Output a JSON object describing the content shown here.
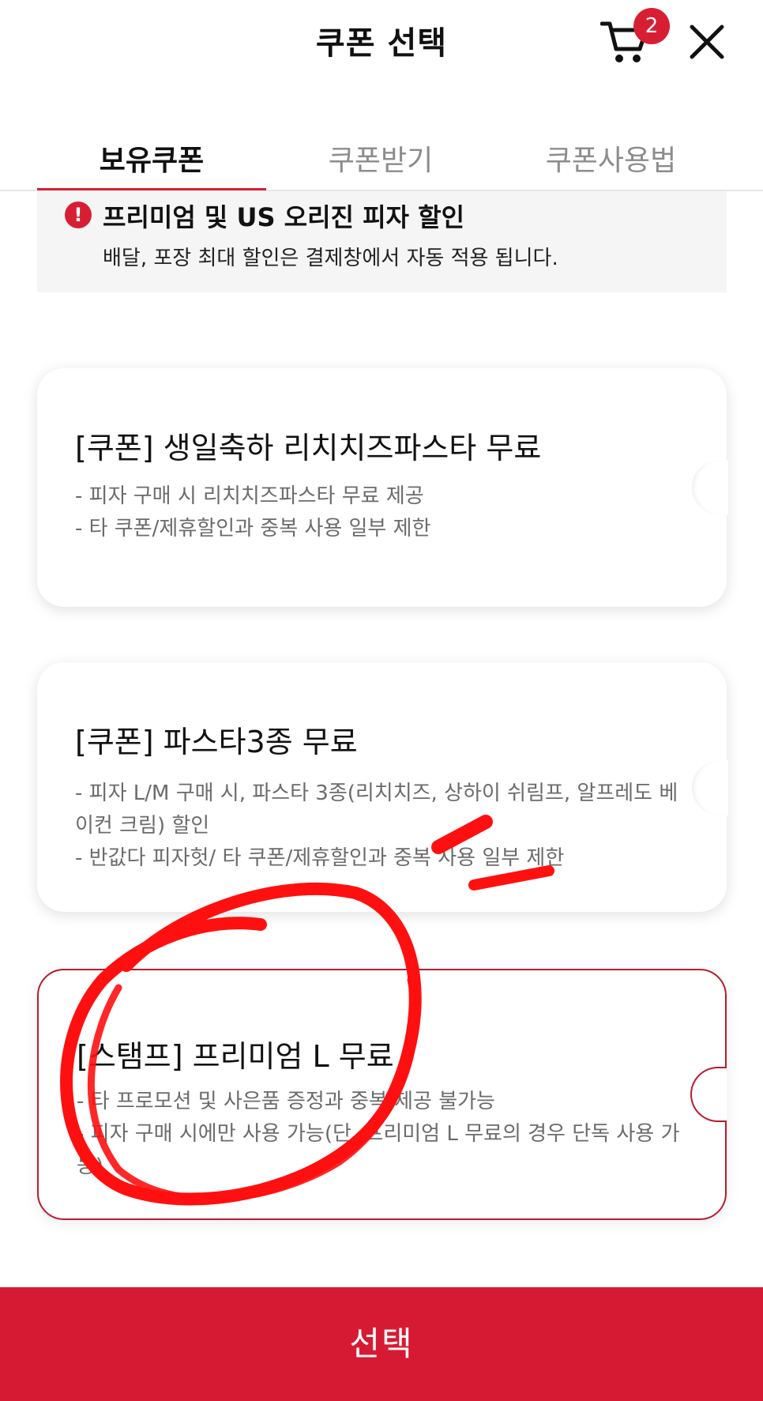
{
  "header": {
    "title": "쿠폰 선택",
    "cart_count": "2",
    "cart_icon": "cart-icon",
    "close_icon": "close-icon"
  },
  "tabs": [
    {
      "label": "보유쿠폰",
      "active": true
    },
    {
      "label": "쿠폰받기",
      "active": false
    },
    {
      "label": "쿠폰사용법",
      "active": false
    }
  ],
  "notice": {
    "icon": "alert-icon",
    "title": "프리미엄 및 US 오리진 피자 할인",
    "text": "배달, 포장 최대 할인은 결제창에서 자동 적용 됩니다."
  },
  "coupons": [
    {
      "title": "[쿠폰] 생일축하 리치치즈파스타 무료",
      "desc": "- 피자 구매 시 리치치즈파스타 무료 제공\n- 타 쿠폰/제휴할인과 중복 사용 일부 제한",
      "selected": false
    },
    {
      "title": "[쿠폰] 파스타3종 무료",
      "desc": "- 피자 L/M 구매 시, 파스타 3종(리치치즈, 상하이 쉬림프, 알프레도 베이컨 크림) 할인\n- 반값다 피자헛/ 타 쿠폰/제휴할인과 중복 사용 일부 제한",
      "selected": false
    },
    {
      "title": "[스탬프] 프리미엄 L 무료",
      "desc": "- 타 프로모션 및 사은품 증정과 중복 제공 불가능\n- 피자 구매 시에만 사용 가능(단, 프리미엄 L 무료의 경우 단독 사용 가능)",
      "selected": true
    }
  ],
  "footer": {
    "select_label": "선택"
  },
  "colors": {
    "accent": "#d71a33",
    "annotation": "#ff1010"
  }
}
